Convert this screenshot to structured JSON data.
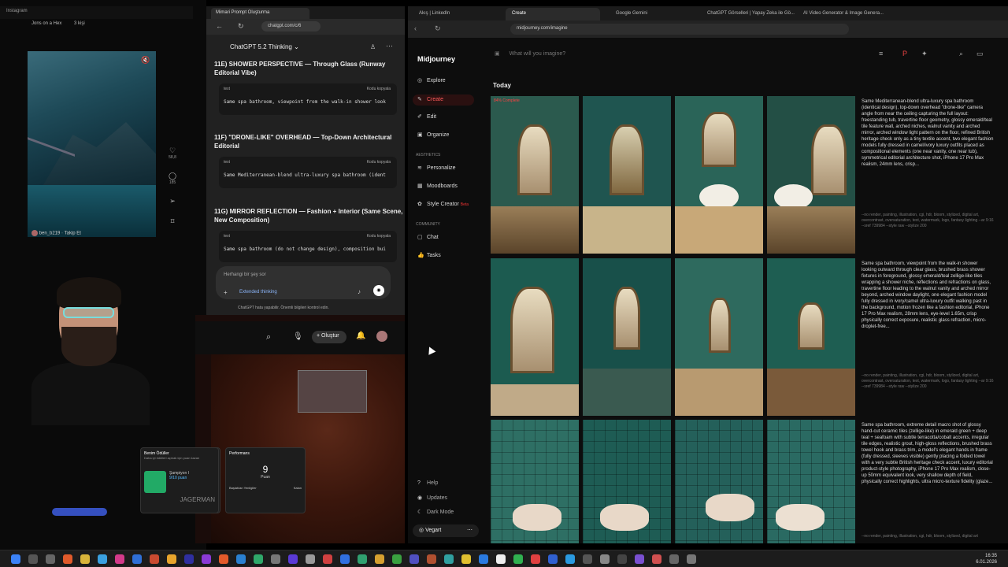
{
  "instagram": {
    "tab": "Instagram",
    "top_items": [
      "Jons on a Hex",
      "3 kişi"
    ],
    "user": "ben_b219",
    "follow": "Takip Et",
    "likes": "58,8",
    "comments": "185"
  },
  "gpt": {
    "tab_title": "Mimari Prompt Oluşturma",
    "url": "chatgpt.com/c/6",
    "model": "ChatGPT 5.2 Thinking",
    "sections": [
      {
        "heading": "11E) SHOWER PERSPECTIVE — Through Glass (Runway Editorial Vibe)",
        "lang": "text",
        "copy": "Kodu kopyala",
        "code": "Same spa bathroom, viewpoint from the walk-in shower look"
      },
      {
        "heading": "11F) \"DRONE-LIKE\" OVERHEAD — Top-Down Architectural Editorial",
        "lang": "text",
        "copy": "Kodu kopyala",
        "code": "Same Mediterranean-blend ultra-luxury spa bathroom (ident"
      },
      {
        "heading": "11G) MIRROR REFLECTION — Fashion + Interior (Same Scene, New Composition)",
        "lang": "text",
        "copy": "Kodu kopyala",
        "code": "Same spa bathroom (do not change design), composition bui"
      }
    ],
    "input_placeholder": "Herhangi bir şey sor",
    "extended": "Extended thinking",
    "disclaimer": "ChatGPT hata yapabilir. Önemli bilgileri kontrol edin."
  },
  "game": {
    "create_label": "Oluştur",
    "card1_title": "Benim Ödüller",
    "card1_sub": "Daha iyi ödülleri açmak için puan kazan",
    "rank": "Şampiyon I",
    "points": "9/10 puan",
    "card2_title": "Performans",
    "score": "9",
    "score_label": "Puan",
    "won": "Başlatılan Yenilgiler",
    "lost": "Kalan",
    "brand": "JAGERMAN"
  },
  "browser": {
    "tabs": [
      "Akış | LinkedIn",
      "Create",
      "Google Gemini",
      "ChatGPT Görselleri | Yapay Zeka ile Gö...",
      "AI Video Generator & Image Genera..."
    ],
    "url": "midjourney.com/imagine"
  },
  "midjourney": {
    "logo": "Midjourney",
    "search_placeholder": "What will you imagine?",
    "nav": [
      "Explore",
      "Create",
      "Edit",
      "Organize"
    ],
    "aesthetics_label": "AESTHETICS",
    "aesthetics": [
      "Personalize",
      "Moodboards",
      "Style Creator"
    ],
    "beta": "Beta",
    "community_label": "COMMUNITY",
    "community": [
      "Chat",
      "Tasks"
    ],
    "bottom": [
      "Help",
      "Updates",
      "Dark Mode"
    ],
    "user": "Vegart",
    "today": "Today",
    "progress": "84% Complete",
    "descriptions": [
      {
        "text": "Same Mediterranean-blend ultra-luxury spa bathroom (identical design), top-down overhead \"drone-like\" camera angle from near the ceiling capturing the full layout: freestanding tub, travertine floor geometry, glossy emerald/teal tile feature wall, arched niches, walnut vanity and arched mirror, arched window light pattern on the floor, refined British heritage check only as a tiny textile accent, two elegant fashion models fully dressed in camel/ivory luxury outfits placed as compositional elements (one near vanity, one near tub), symmetrical editorial architecture shot, iPhone 17 Pro Max realism, 24mm lens, crisp...",
        "tags": "--no render, painting, illustration, cgi, hdr, bloom, stylized, digital art, overcontrast, oversaturation, text, watermark, logo, fantasy lighting   --ar 9:16   --sref 739984   --style raw   --stylize 200"
      },
      {
        "text": "Same spa bathroom, viewpoint from the walk-in shower looking outward through clear glass, brushed brass shower fixtures in foreground, glossy emerald/teal zellige-like tiles wrapping a shower niche, reflections and refractions on glass, travertine floor leading to the walnut vanity and arched mirror beyond, arched window daylight, one elegant fashion model fully dressed in ivory/camel ultra-luxury outfit walking past in the background, motion frozen like a fashion editorial, iPhone 17 Pro Max realism, 28mm lens, eye-level 1.65m, crisp physically correct exposure, realistic glass refraction, micro-droplet-free...",
        "tags": "--no render, painting, illustration, cgi, hdr, bloom, stylized, digital art, overcontrast, oversaturation, text, watermark, logo, fantasy lighting   --ar 9:16   --sref 739984   --style raw   --stylize 200"
      },
      {
        "text": "Same spa bathroom, extreme detail macro shot of glossy hand-cut ceramic tiles (zellige-like) in emerald green + deep teal + seafoam with subtle terracotta/cobalt accents, irregular tile edges, realistic grout, high-gloss reflections, brushed brass towel hook and brass trim, a model's elegant hands in frame (fully dressed, sleeves visible) gently placing a folded towel with a very subtle British heritage check accent, luxury editorial product-style photography, iPhone 17 Pro Max realism, close-up 50mm equivalent look, very shallow depth of field, physically correct highlights, ultra micro-texture fidelity (glaze...",
        "tags": "--no render, painting, illustration, cgi, hdr, bloom, stylized, digital art"
      }
    ]
  },
  "taskbar": {
    "time": "16:35",
    "date": "6.01.2026"
  }
}
